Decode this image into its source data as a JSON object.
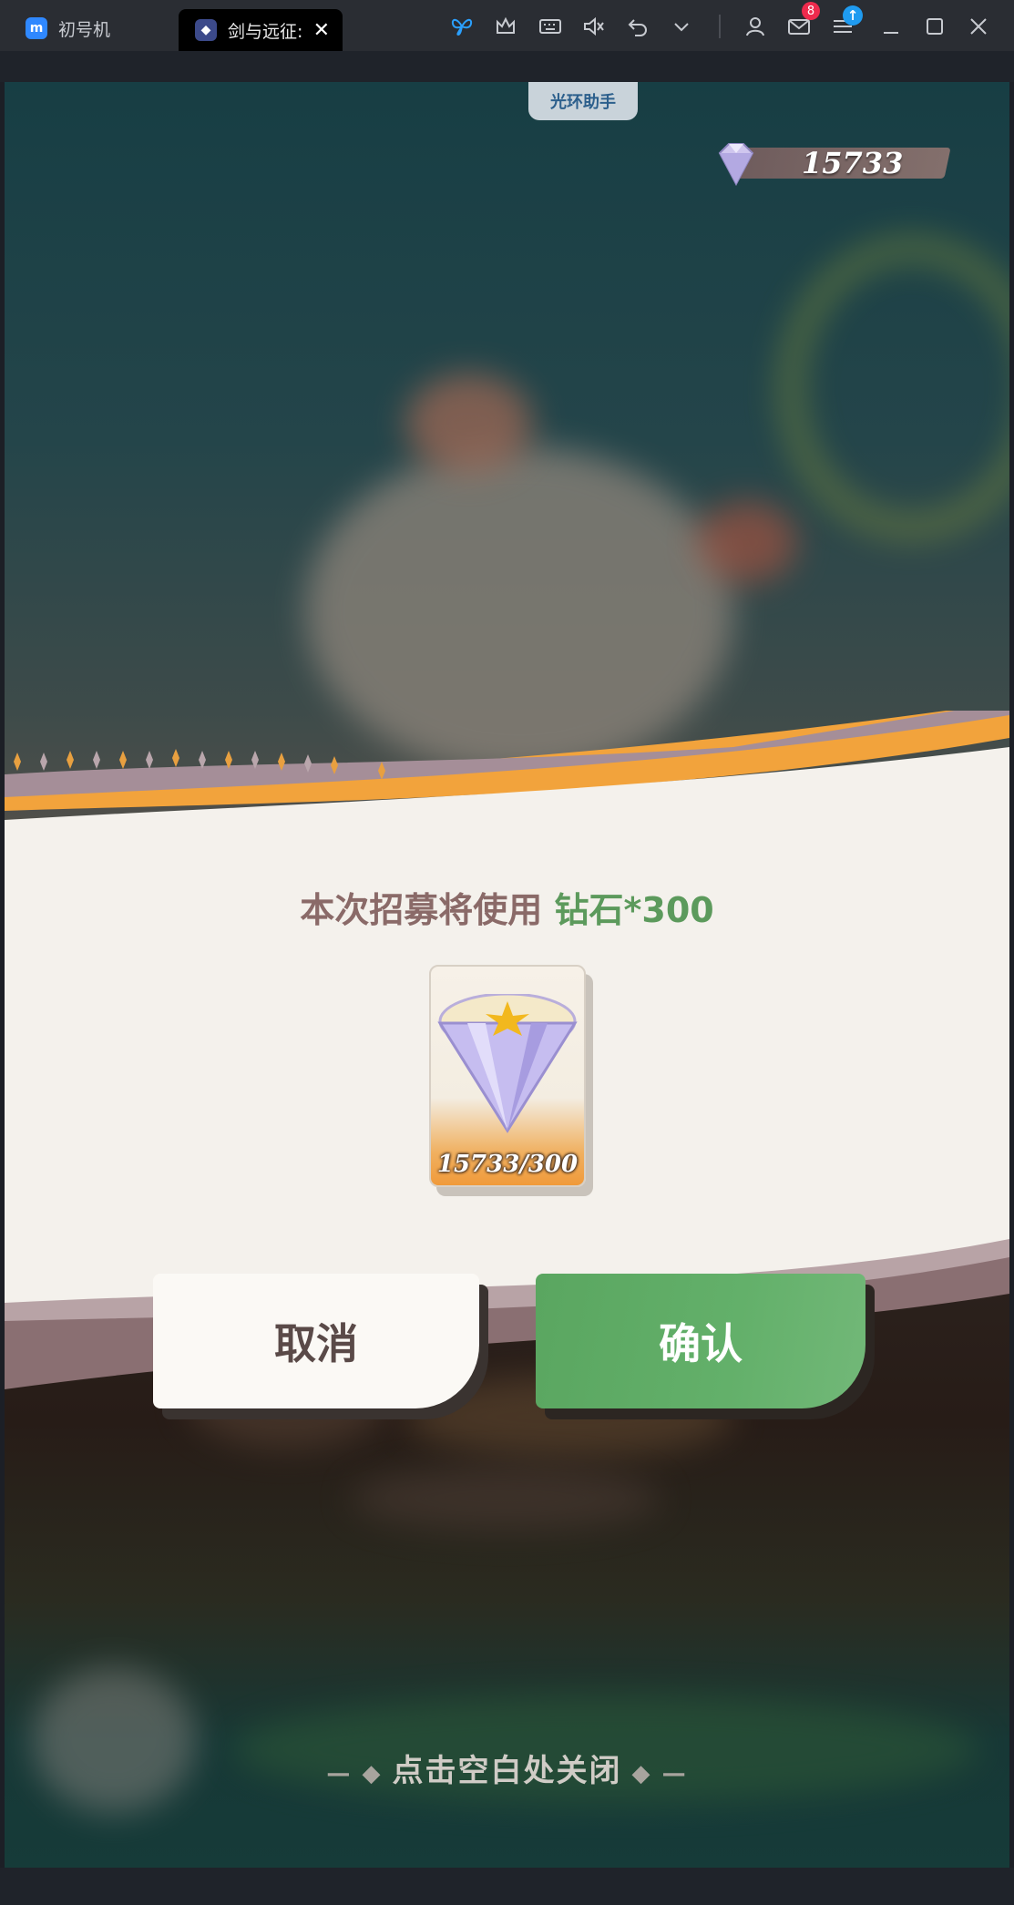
{
  "tabs": [
    {
      "label": "初号机",
      "icon": "emulator-logo-icon",
      "active": false
    },
    {
      "label": "剑与远征:",
      "icon": "game-icon",
      "active": true
    }
  ],
  "toolbar": {
    "icons": [
      "butterfly-icon",
      "crown-icon",
      "keyboard-icon",
      "mute-icon",
      "undo-icon",
      "chevron-down-icon",
      "user-icon",
      "mail-icon",
      "menu-icon",
      "minimize-icon",
      "maximize-icon",
      "close-icon"
    ],
    "mail_badge": "8"
  },
  "game": {
    "helper_label": "光环助手",
    "diamond_count": "15733",
    "dialog": {
      "title_prefix": "本次招募将使用 ",
      "title_cost": "钻石*300",
      "card_count": "15733/300",
      "cancel_label": "取消",
      "confirm_label": "确认"
    },
    "close_hint": "点击空白处关闭"
  },
  "colors": {
    "accent_green": "#5aa660",
    "ribbon_orange": "#f2a33c",
    "dialog_bg": "#f4f1ec"
  }
}
